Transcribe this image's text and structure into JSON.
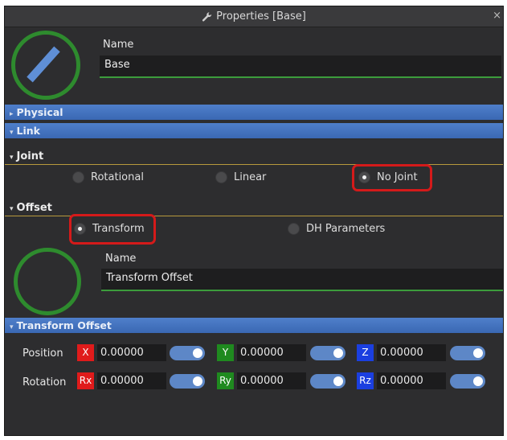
{
  "window": {
    "title": "Properties [Base]",
    "close_label": "×"
  },
  "base": {
    "name_label": "Name",
    "name_value": "Base"
  },
  "sections": {
    "physical": "Physical",
    "link": "Link",
    "transform_offset": "Transform Offset"
  },
  "joint": {
    "header": "Joint",
    "options": [
      "Rotational",
      "Linear",
      "No Joint"
    ],
    "selected": "No Joint"
  },
  "offset": {
    "header": "Offset",
    "options": [
      "Transform",
      "DH Parameters"
    ],
    "selected": "Transform",
    "name_label": "Name",
    "name_value": "Transform Offset"
  },
  "transform": {
    "position_label": "Position",
    "rotation_label": "Rotation",
    "position": [
      {
        "axis": "X",
        "value": "0.00000",
        "color": "#e01b1b"
      },
      {
        "axis": "Y",
        "value": "0.00000",
        "color": "#1f8a1f"
      },
      {
        "axis": "Z",
        "value": "0.00000",
        "color": "#1b3fe0"
      }
    ],
    "rotation": [
      {
        "axis": "Rx",
        "value": "0.00000",
        "color": "#e01b1b"
      },
      {
        "axis": "Ry",
        "value": "0.00000",
        "color": "#1f8a1f"
      },
      {
        "axis": "Rz",
        "value": "0.00000",
        "color": "#1b3fe0"
      }
    ]
  },
  "colors": {
    "accent": "#3a68b3",
    "green": "#2e8b2e",
    "highlight": "#d41a1a"
  }
}
